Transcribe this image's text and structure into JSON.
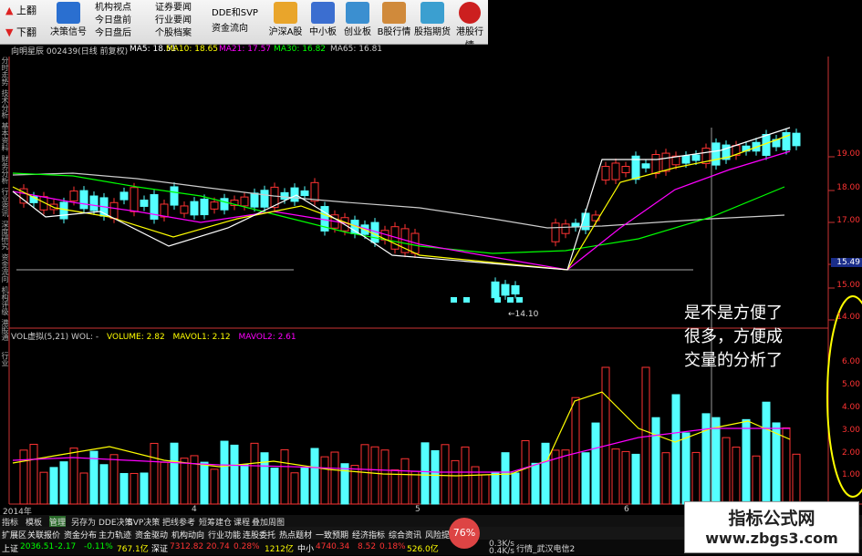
{
  "toolbar": {
    "up": "上翻",
    "down": "下翻",
    "decision": "决策信号",
    "col1": [
      "机构视点",
      "今日盘前",
      "今日盘后"
    ],
    "col2": [
      "证券要闻",
      "行业要闻",
      "个股档案"
    ],
    "col3": [
      "DDE和SVP",
      "资金流向"
    ],
    "buttons": [
      "沪深A股",
      "中小板",
      "创业板",
      "B股行情",
      "股指期货",
      "港股行情"
    ]
  },
  "title": {
    "stock": "向明星辰 002439(日线 前复权)",
    "ma5": "MA5: 18.51",
    "ma10": "MA10: 18.65",
    "ma21": "MA21: 17.57",
    "ma30": "MA30: 16.82",
    "ma65": "MA65: 16.81"
  },
  "left_tabs": [
    "分时走势",
    "技术分析",
    "基本资料",
    "财务分析",
    "行业资讯",
    "深度研究",
    "资金流向",
    "机构评级",
    "港股通",
    "行业"
  ],
  "price_axis": [
    "19.00",
    "18.00",
    "17.00",
    "15.49",
    "15.00",
    "14.00"
  ],
  "price_labels": {
    "low_label": "14.10"
  },
  "volume_legend": {
    "main": "VOL虚拟(5,21) WOL: -",
    "volume": "VOLUME: 2.82",
    "mavol1": "MAVOL1: 2.12",
    "mavol2": "MAVOL2: 2.61"
  },
  "volume_axis": [
    "6.00",
    "5.00",
    "4.00",
    "3.00",
    "2.00",
    "1.00"
  ],
  "date_axis": {
    "year": "2014年",
    "m4": "4",
    "m5": "5",
    "m6": "6"
  },
  "tabs_row1": [
    "指标",
    "模板",
    "管理",
    "另存为",
    "DDE决策",
    "SVP决策",
    "把线参考",
    "短筹建仓",
    "课程",
    "叠加周图"
  ],
  "tabs_row2": [
    "扩展区",
    "关联报价",
    "资金分布",
    "主力轨迹",
    "资金驱动",
    "机构动向",
    "行业功能",
    "连股委托",
    "热点题材",
    "一致预期",
    "经济指标",
    "综合资讯",
    "风险提示"
  ],
  "status": {
    "sh_label": "上证",
    "sh_value": "2036.51",
    "sh_change": "-2.17",
    "sh_pct": "-0.11%",
    "sh_amount": "767.1亿",
    "sz_label": "深证",
    "sz_value": "7312.82",
    "sz_change": "20.74",
    "sz_pct": "0.28%",
    "sz_amount": "1212亿",
    "zx_label": "中小",
    "zx_value": "4740.34",
    "zx_change": "8.52",
    "zx_pct": "0.18%",
    "zx_amount": "526.0亿",
    "speed_up": "0.3K/s",
    "speed_down": "0.4K/s",
    "news": "行情_武汉电信2"
  },
  "overlay_percent": "76%",
  "annotation": [
    "是不是方便了",
    "很多，方便成",
    "交量的分析了"
  ],
  "watermark": {
    "title": "指标公式网",
    "url": "www.zbgs3.com"
  },
  "colors": {
    "up": "#ff3333",
    "down": "#54ffff",
    "ma5": "#ffffff",
    "ma10": "#ffff00",
    "ma21": "#ff00ff",
    "ma30": "#00ff00",
    "ma65": "#cccccc"
  }
}
